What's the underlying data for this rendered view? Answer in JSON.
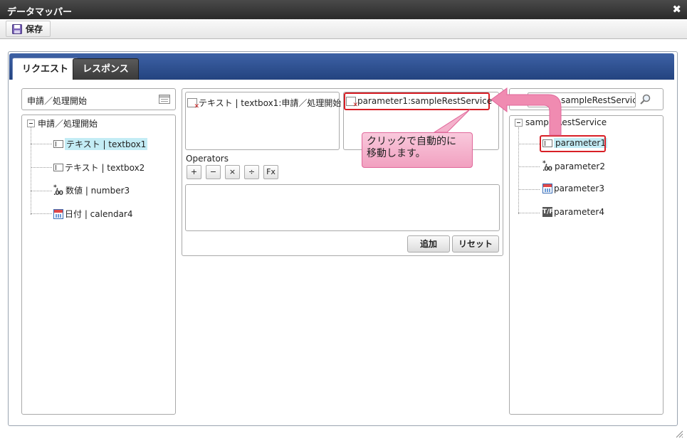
{
  "window": {
    "title": "データマッパー",
    "close_glyph": "✖"
  },
  "toolbar": {
    "save_label": "保存"
  },
  "tabs": [
    {
      "label": "リクエスト",
      "active": true
    },
    {
      "label": "レスポンス",
      "active": false
    }
  ],
  "left_panel": {
    "header": "申請／処理開始",
    "tree": {
      "root": "申請／処理開始",
      "items": [
        {
          "label": "テキスト | textbox1",
          "icon": "textbox-icon",
          "highlighted": true
        },
        {
          "label": "テキスト | textbox2",
          "icon": "textbox-icon"
        },
        {
          "label": "数値 | number3",
          "icon": "number-icon"
        },
        {
          "label": "日付 | calendar4",
          "icon": "calendar-icon"
        }
      ]
    }
  },
  "middle_panel": {
    "source_mapping": "テキスト | textbox1:申請／処理開始",
    "target_mapping": "parameter1:sampleRestService",
    "operators_label": "Operators",
    "operators": [
      "+",
      "−",
      "×",
      "÷",
      "Fx"
    ],
    "add_button": "追加",
    "reset_button": "リセット"
  },
  "right_panel": {
    "search_value": "sampleRestService",
    "tree": {
      "root": "sampleRestService",
      "items": [
        {
          "label": "parameter1",
          "icon": "textbox-icon",
          "highlighted": true
        },
        {
          "label": "parameter2",
          "icon": "number-icon"
        },
        {
          "label": "parameter3",
          "icon": "calendar-icon"
        },
        {
          "label": "parameter4",
          "icon": "boolean-icon"
        }
      ]
    }
  },
  "callout": {
    "line1": "クリックで自動的に",
    "line2": "移動します。"
  },
  "icons": {
    "number_glyph": "*,0\n.00",
    "boolean_glyph": "T/F"
  },
  "colors": {
    "tab_bar": "#2f5398",
    "highlight": "#c3ecf5",
    "callout": "#f4b1cb",
    "red_box": "#d81f26"
  }
}
